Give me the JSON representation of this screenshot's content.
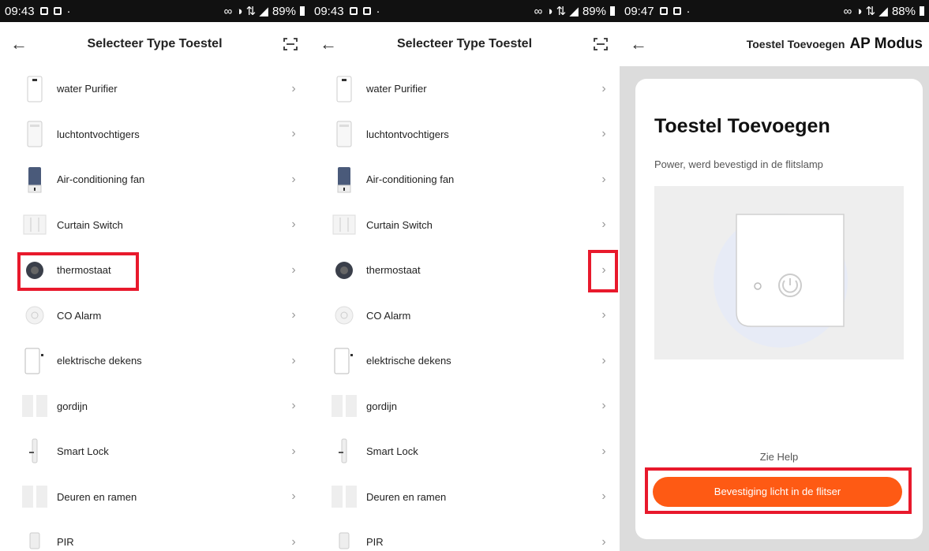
{
  "screens": [
    {
      "status": {
        "time": "09:43",
        "battery": "89%"
      },
      "title": "Selecteer Type Toestel",
      "items": [
        {
          "label": "water Purifier",
          "icon": "water-purifier-icon"
        },
        {
          "label": "luchtontvochtigers",
          "icon": "dehumidifier-icon"
        },
        {
          "label": "Air-conditioning fan",
          "icon": "aircon-fan-icon"
        },
        {
          "label": "Curtain Switch",
          "icon": "curtain-switch-icon"
        },
        {
          "label": "thermostaat",
          "icon": "thermostat-icon"
        },
        {
          "label": "CO Alarm",
          "icon": "co-alarm-icon"
        },
        {
          "label": "elektrische dekens",
          "icon": "electric-blanket-icon"
        },
        {
          "label": "gordijn",
          "icon": "curtain-icon"
        },
        {
          "label": "Smart Lock",
          "icon": "smart-lock-icon"
        },
        {
          "label": "Deuren en ramen",
          "icon": "door-window-icon"
        },
        {
          "label": "PIR",
          "icon": "pir-icon"
        }
      ],
      "chevron": "›"
    },
    {
      "status": {
        "time": "09:43",
        "battery": "89%"
      },
      "title": "Selecteer Type Toestel",
      "items": [
        {
          "label": "water Purifier"
        },
        {
          "label": "luchtontvochtigers"
        },
        {
          "label": "Air-conditioning fan"
        },
        {
          "label": "Curtain Switch"
        },
        {
          "label": "thermostaat"
        },
        {
          "label": "CO Alarm"
        },
        {
          "label": "elektrische dekens"
        },
        {
          "label": "gordijn"
        },
        {
          "label": "Smart Lock"
        },
        {
          "label": "Deuren en ramen"
        },
        {
          "label": "PIR"
        }
      ],
      "chevron": "›"
    },
    {
      "status": {
        "time": "09:47",
        "battery": "88%"
      },
      "title": "Toestel Toevoegen",
      "mode": "AP Modus",
      "heading": "Toestel Toevoegen",
      "subtitle": "Power, werd bevestigd in de flitslamp",
      "help": "Zie Help",
      "confirm_button": "Bevestiging licht in de flitser"
    }
  ],
  "back_glyph": "←",
  "colors": {
    "accent": "#fe5a14",
    "highlight": "#e8192c",
    "page_bg": "#dcdcdc"
  }
}
